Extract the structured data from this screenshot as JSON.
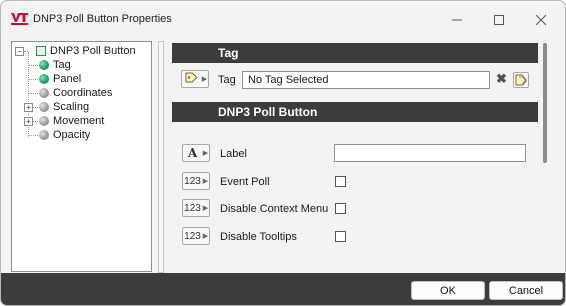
{
  "window": {
    "title": "DNP3 Poll Button Properties",
    "logo_icon": "vtscada-logo-icon",
    "controls": [
      "minimize-icon",
      "maximize-icon",
      "close-icon"
    ]
  },
  "tree": {
    "root": "DNP3 Poll Button",
    "items": [
      {
        "label": "Tag",
        "status": "green",
        "expandable": false
      },
      {
        "label": "Panel",
        "status": "green",
        "expandable": false
      },
      {
        "label": "Coordinates",
        "status": "gray",
        "expandable": false
      },
      {
        "label": "Scaling",
        "status": "gray",
        "expandable": true
      },
      {
        "label": "Movement",
        "status": "gray",
        "expandable": true
      },
      {
        "label": "Opacity",
        "status": "gray",
        "expandable": false
      }
    ]
  },
  "sections": {
    "tag_header": "Tag",
    "widget_header": "DNP3 Poll Button"
  },
  "tag_row": {
    "label": "Tag",
    "value": "No Tag Selected",
    "clear_icon": "clear-x-icon",
    "browse_icon": "tag-browse-icon"
  },
  "properties": [
    {
      "label": "Label",
      "type_icon": "text-type-icon",
      "type_symbol": "A",
      "control": "text",
      "value": ""
    },
    {
      "label": "Event Poll",
      "type_icon": "numeric-type-icon",
      "type_symbol": "123",
      "control": "checkbox",
      "checked": false
    },
    {
      "label": "Disable Context Menu",
      "type_icon": "numeric-type-icon",
      "type_symbol": "123",
      "control": "checkbox",
      "checked": false
    },
    {
      "label": "Disable Tooltips",
      "type_icon": "numeric-type-icon",
      "type_symbol": "123",
      "control": "checkbox",
      "checked": false
    }
  ],
  "buttons": {
    "ok": "OK",
    "cancel": "Cancel"
  },
  "colors": {
    "header_bg": "#3c3c3c",
    "status_green": "#14925a",
    "status_gray": "#8f8f8f",
    "logo_red": "#c8102e"
  }
}
